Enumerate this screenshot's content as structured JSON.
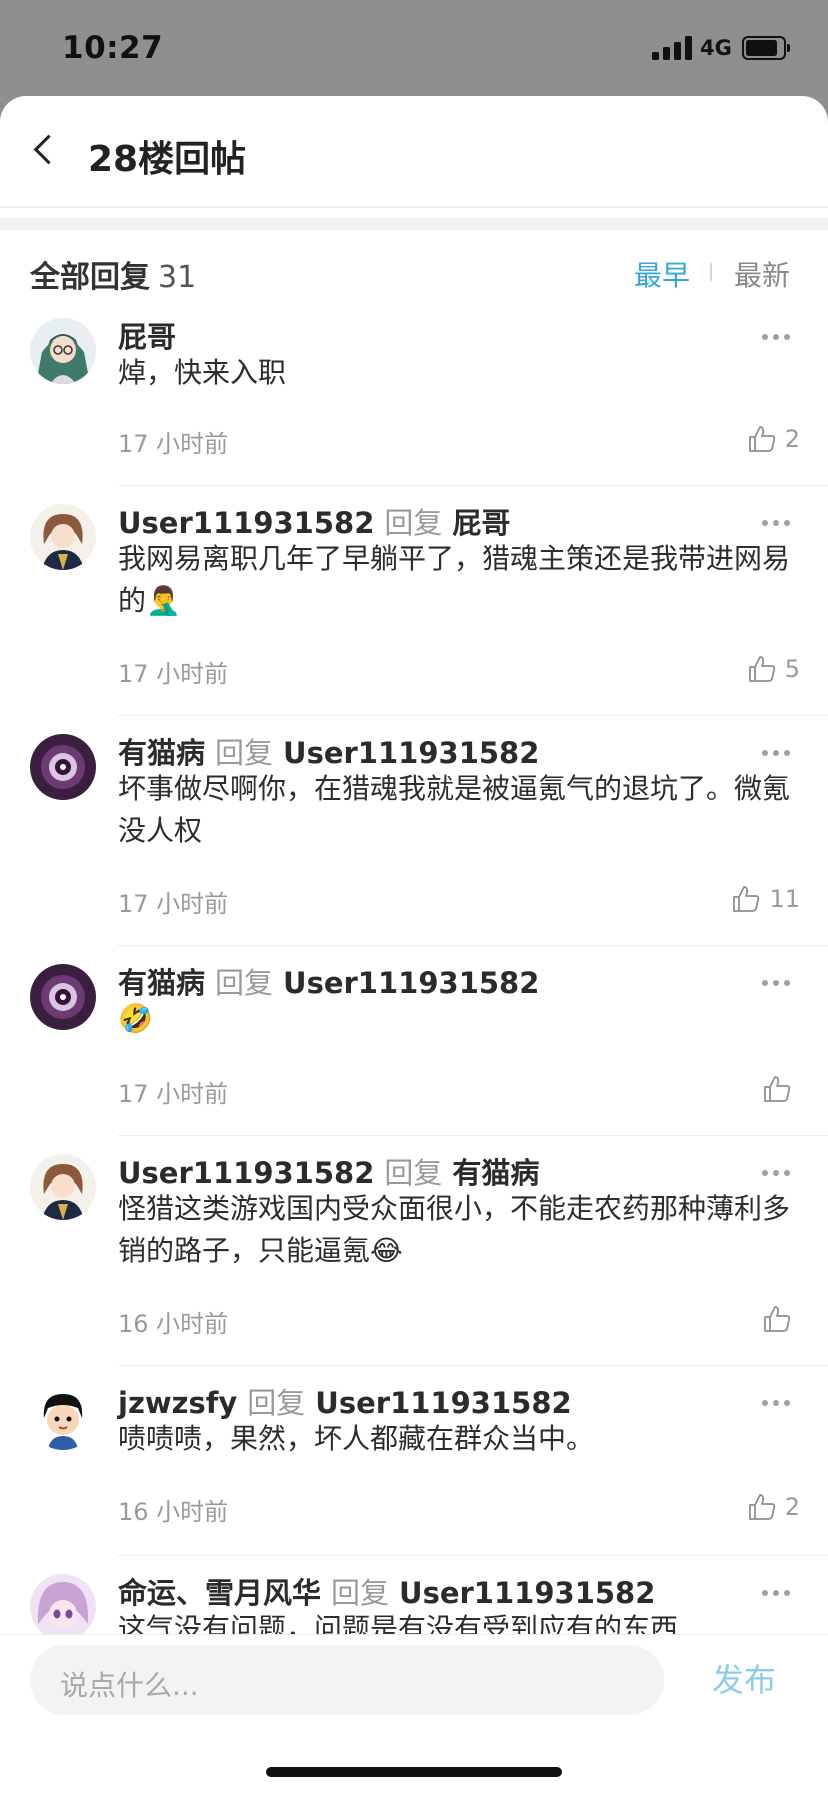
{
  "status_bar": {
    "time": "10:27",
    "network": "4G"
  },
  "nav": {
    "title": "28楼回帖"
  },
  "header": {
    "title": "全部回复",
    "count": "31",
    "sort_early": "最早",
    "sort_new": "最新"
  },
  "colors": {
    "accent": "#36a7d6",
    "publish_disabled": "#8ccde9"
  },
  "replies": [
    {
      "avatar": "anime-green-hair-avatar",
      "user": "屁哥",
      "verb": "",
      "target": "",
      "text": "焯，快来入职",
      "time": "17 小时前",
      "likes": "2"
    },
    {
      "avatar": "anime-brown-hair-avatar",
      "user": "User111931582",
      "verb": "回复",
      "target": "屁哥",
      "text": "我网易离职几年了早躺平了，猎魂主策还是我带进网易的🤦‍♂️",
      "time": "17 小时前",
      "likes": "5"
    },
    {
      "avatar": "purple-eye-avatar",
      "user": "有猫病",
      "verb": "回复",
      "target": "User111931582",
      "text": "坏事做尽啊你，在猎魂我就是被逼氪气的退坑了。微氪没人权",
      "time": "17 小时前",
      "likes": "11"
    },
    {
      "avatar": "purple-eye-avatar",
      "user": "有猫病",
      "verb": "回复",
      "target": "User111931582",
      "text": "🤣",
      "time": "17 小时前",
      "likes": ""
    },
    {
      "avatar": "anime-brown-hair-avatar",
      "user": "User111931582",
      "verb": "回复",
      "target": "有猫病",
      "text": "怪猎这类游戏国内受众面很小，不能走农药那种薄利多销的路子，只能逼氪😂",
      "time": "16 小时前",
      "likes": ""
    },
    {
      "avatar": "cartoon-boy-avatar",
      "user": "jzwzsfy",
      "verb": "回复",
      "target": "User111931582",
      "text": "啧啧啧，果然，坏人都藏在群众当中。",
      "time": "16 小时前",
      "likes": "2"
    },
    {
      "avatar": "anime-pink-hair-avatar",
      "user": "命运、雪月风华",
      "verb": "回复",
      "target": "User111931582",
      "text": "这气没有问题，问题是有没有受到应有的东西",
      "time": "",
      "likes": ""
    }
  ],
  "composer": {
    "placeholder": "说点什么...",
    "publish": "发布"
  }
}
